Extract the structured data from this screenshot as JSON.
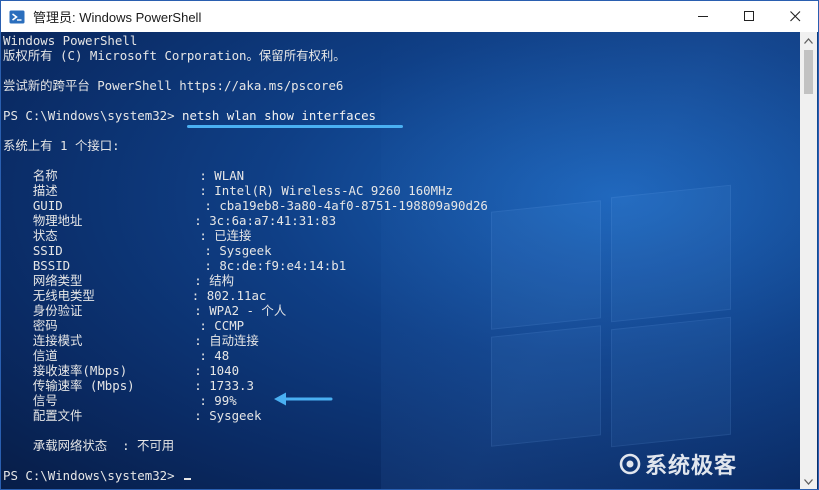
{
  "window": {
    "title": "管理员: Windows PowerShell"
  },
  "console": {
    "lines": [
      "Windows PowerShell",
      "版权所有 (C) Microsoft Corporation。保留所有权利。",
      "",
      "尝试新的跨平台 PowerShell https://aka.ms/pscore6",
      "",
      "",
      "",
      "系统上有 1 个接口:",
      "",
      "    名称                   : WLAN",
      "    描述                   : Intel(R) Wireless-AC 9260 160MHz",
      "    GUID                   : cba19eb8-3a80-4af0-8751-198809a90d26",
      "    物理地址               : 3c:6a:a7:41:31:83",
      "    状态                   : 已连接",
      "    SSID                   : Sysgeek",
      "    BSSID                  : 8c:de:f9:e4:14:b1",
      "    网络类型               : 结构",
      "    无线电类型             : 802.11ac",
      "    身份验证               : WPA2 - 个人",
      "    密码                   : CCMP",
      "    连接模式               : 自动连接",
      "    信道                   : 48",
      "    接收速率(Mbps)         : 1040",
      "    传输速率 (Mbps)        : 1733.3",
      "    信号                   : 99%",
      "    配置文件               : Sysgeek",
      "",
      "    承载网络状态  : 不可用",
      ""
    ],
    "prompt1": "PS C:\\Windows\\system32> ",
    "command": "netsh wlan show interfaces",
    "prompt2": "PS C:\\Windows\\system32> "
  },
  "watermark": {
    "text": "系统极客"
  },
  "colors": {
    "console_bg": "#0f3f86",
    "console_text": "#e6e6e6",
    "annotation": "#4ab0f2"
  }
}
